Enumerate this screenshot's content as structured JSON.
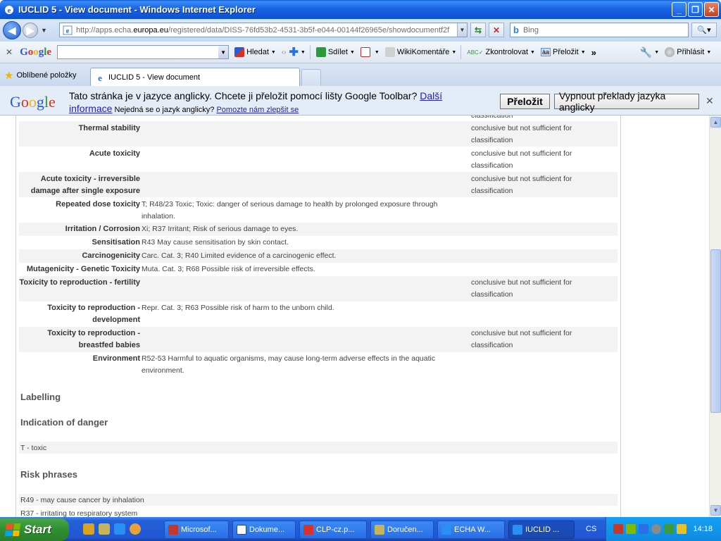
{
  "window": {
    "title": "IUCLID 5 - View document - Windows Internet Explorer",
    "buttons": {
      "minimize": "_",
      "maximize": "❐",
      "close": "✕"
    }
  },
  "addressbar": {
    "url_prefix": "http://apps.echa.",
    "url_domain": "europa.eu",
    "url_rest": "/registered/data/DISS-76fd53b2-4531-3b5f-e044-00144f26965e/showdocumentf2f",
    "search_placeholder": "Bing"
  },
  "google_toolbar": {
    "close": "✕",
    "logo": [
      "G",
      "o",
      "o",
      "g",
      "l",
      "e"
    ],
    "items": {
      "hledat": "Hledat",
      "sdilet": "Sdílet",
      "wikikomentare": "WikiKomentáře",
      "zkontrolovat": "Zkontrolovat",
      "prelozit": "Přeložit",
      "more": "»",
      "prihlasit": "Přihlásit"
    }
  },
  "tabs": {
    "favorites": "Oblíbené položky",
    "active_tab": "IUCLID 5 - View document"
  },
  "translate_bar": {
    "message": "Tato stránka je v jazyce anglicky. Chcete ji přeložit pomocí lišty Google Toolbar?",
    "more_info_1": "Další",
    "more_info_2": "informace",
    "not_english": "Nejedná se o jazyk anglicky?",
    "help_improve": "Pomozte nám zlepšit se",
    "translate_button": "Přeložit",
    "turn_off_button": "Vypnout překlady jazyka anglicky"
  },
  "document": {
    "top_cut": "classification",
    "rows": [
      {
        "label": "Thermal stability",
        "value": "",
        "conclusion": "conclusive but not sufficient for classification"
      },
      {
        "label": "Acute toxicity",
        "value": "",
        "conclusion": "conclusive but not sufficient for classification"
      },
      {
        "label": "Acute toxicity - irreversible damage after single exposure",
        "value": "",
        "conclusion": "conclusive but not sufficient for classification"
      },
      {
        "label": "Repeated dose toxicity",
        "value": "T; R48/23 Toxic; Toxic: danger of serious damage to health by prolonged exposure through inhalation.",
        "conclusion": ""
      },
      {
        "label": "Irritation / Corrosion",
        "value": "Xi; R37 Irritant; Risk of serious damage to eyes.",
        "conclusion": ""
      },
      {
        "label": "Sensitisation",
        "value": "R43 May cause sensitisation by skin contact.",
        "conclusion": ""
      },
      {
        "label": "Carcinogenicity",
        "value": "Carc. Cat. 3; R40 Limited evidence of a carcinogenic effect.",
        "conclusion": ""
      },
      {
        "label": "Mutagenicity - Genetic Toxicity",
        "value": "Muta. Cat. 3; R68 Possible risk of irreversible effects.",
        "conclusion": ""
      },
      {
        "label": "Toxicity to reproduction - fertility",
        "value": "",
        "conclusion": "conclusive but not sufficient for classification"
      },
      {
        "label": "Toxicity to reproduction - development",
        "value": "Repr. Cat. 3; R63 Possible risk of harm to the unborn child.",
        "conclusion": ""
      },
      {
        "label": "Toxicity to reproduction - breastfed babies",
        "value": "",
        "conclusion": "conclusive but not sufficient for classification"
      },
      {
        "label": "Environment",
        "value": "R52-53 Harmful to aquatic organisms, may cause long-term adverse effects in the aquatic environment.",
        "conclusion": ""
      }
    ],
    "labelling_heading": "Labelling",
    "danger_heading": "Indication of danger",
    "danger_item": "T - toxic",
    "risk_heading": "Risk phrases",
    "risk_items": [
      "R49 - may cause cancer by inhalation",
      "R37 - irritating to respiratory system"
    ]
  },
  "taskbar": {
    "start": "Start",
    "tasks": [
      "Microsof...",
      "Dokume...",
      "CLP-cz.p...",
      "Doručen...",
      "ECHA W...",
      "IUCLID ..."
    ],
    "language": "CS",
    "time": "14:18"
  },
  "colors": {
    "titlebar": "#0b50d2",
    "link": "#2020c0",
    "row_shade": "#f3f3f3"
  }
}
